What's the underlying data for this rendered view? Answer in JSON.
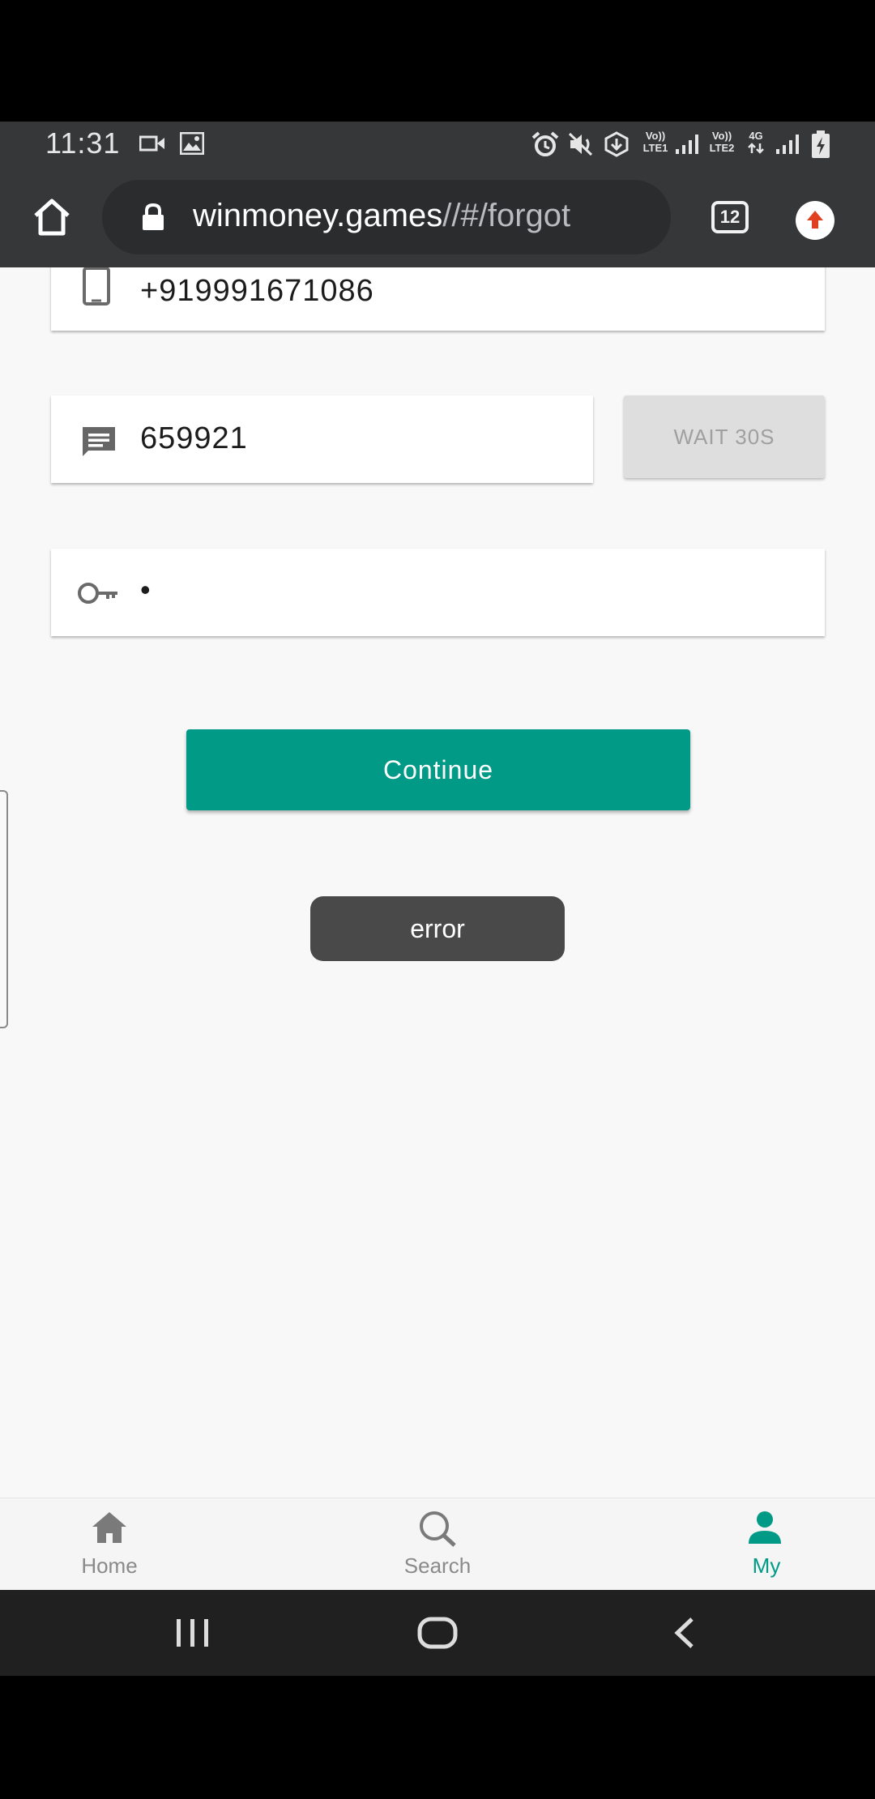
{
  "status_bar": {
    "time": "11:31",
    "volte1": "Vo))",
    "lte1": "LTE1",
    "volte2": "Vo))",
    "lte2": "LTE2",
    "net_type": "4G"
  },
  "browser": {
    "url_domain": "winmoney.games",
    "url_path": "//#/forgot",
    "tab_count": "12"
  },
  "form": {
    "phone_value": "+919991671086",
    "otp_value": "659921",
    "wait_label": "WAIT 30S",
    "password_value": "•",
    "continue_label": "Continue"
  },
  "toast": {
    "message": "error"
  },
  "bottom_nav": {
    "items": [
      {
        "label": "Home",
        "icon": "home-icon"
      },
      {
        "label": "Search",
        "icon": "search-icon"
      },
      {
        "label": "My",
        "icon": "person-icon"
      }
    ],
    "active_color": "#009a86",
    "inactive_color": "#8a8a8a"
  },
  "colors": {
    "accent": "#009a86",
    "browser_bar": "#353739",
    "page_bg": "#f8f8f8"
  }
}
